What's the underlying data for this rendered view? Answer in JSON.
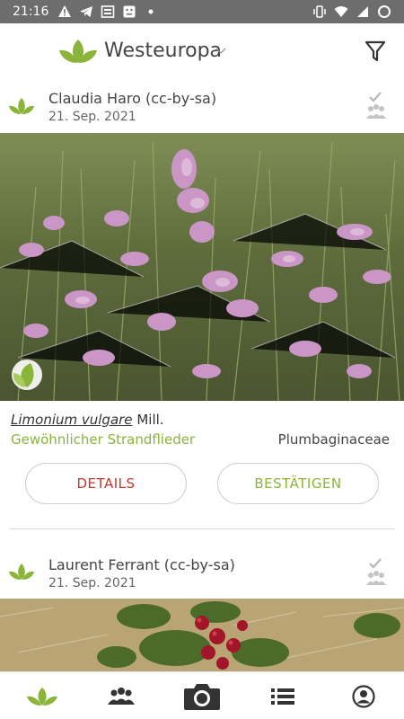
{
  "status_bar": {
    "time": "21:16"
  },
  "header": {
    "region": "Westeuropa"
  },
  "observations": [
    {
      "author": "Claudia Haro (cc-by-sa)",
      "date": "21. Sep. 2021",
      "scientific_name": "Limonium vulgare",
      "authority": "Mill.",
      "common_name": "Gewöhnlicher Strandflieder",
      "family": "Plumbaginaceae",
      "details_label": "DETAILS",
      "confirm_label": "BESTÄTIGEN"
    },
    {
      "author": "Laurent Ferrant (cc-by-sa)",
      "date": "21. Sep. 2021"
    }
  ],
  "bottom_nav": [
    "leaf-icon",
    "community-icon",
    "camera-icon",
    "list-icon",
    "profile-icon"
  ],
  "colors": {
    "accent_green": "#8bb43a",
    "details_red": "#c0392b",
    "status_bar": "#6d6d6d"
  }
}
